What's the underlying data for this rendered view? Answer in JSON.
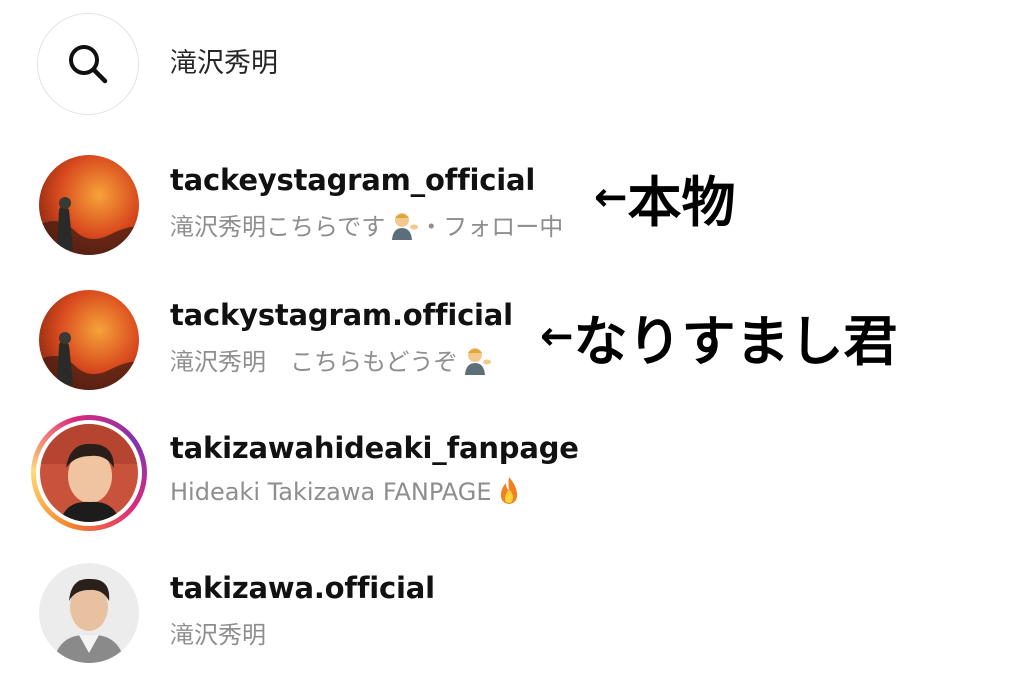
{
  "search": {
    "query": "滝沢秀明",
    "icon": "search-icon"
  },
  "results": [
    {
      "username": "tackeystagram_official",
      "subtitle": "滝沢秀明こちらです",
      "subtitle_suffix": "・フォロー中",
      "emoji": "person-tipping-hand-emoji",
      "avatar": "volcano-avatar"
    },
    {
      "username": "tackystagram.official",
      "subtitle": "滝沢秀明　こちらもどうぞ",
      "emoji": "person-tipping-hand-emoji",
      "avatar": "volcano-avatar"
    },
    {
      "username": "takizawahideaki_fanpage",
      "subtitle": "Hideaki Takizawa FANPAGE",
      "emoji": "fire-emoji",
      "avatar": "portrait-avatar-story-ring"
    },
    {
      "username": "takizawa.official",
      "subtitle": "滝沢秀明",
      "avatar": "portrait-avatar"
    }
  ],
  "annotations": {
    "arrow": "←",
    "real": "本物",
    "fake": "なりすまし君"
  },
  "colors": {
    "text_primary": "#111111",
    "text_secondary": "#8e8e8e",
    "volcano_red": "#d94a1e",
    "story_ring": [
      "#f58529",
      "#dd2a7b",
      "#8134af"
    ]
  }
}
